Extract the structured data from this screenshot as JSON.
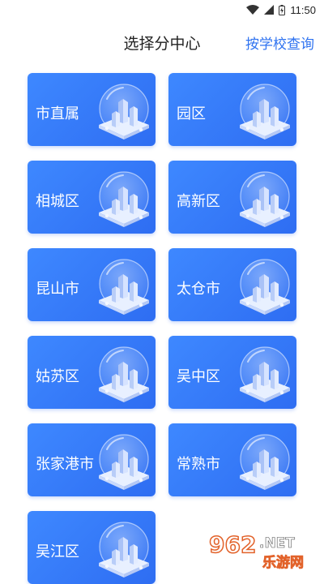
{
  "status": {
    "time": "11:50"
  },
  "header": {
    "title": "选择分中心",
    "link": "按学校查询"
  },
  "centers": [
    "市直属",
    "园区",
    "相城区",
    "高新区",
    "昆山市",
    "太仓市",
    "姑苏区",
    "吴中区",
    "张家港市",
    "常熟市",
    "吴江区"
  ],
  "watermark": {
    "logo": "962",
    "net": ".NET",
    "name": "乐游网"
  },
  "colors": {
    "accent": "#2f73f0",
    "card": "#3a80fb"
  }
}
